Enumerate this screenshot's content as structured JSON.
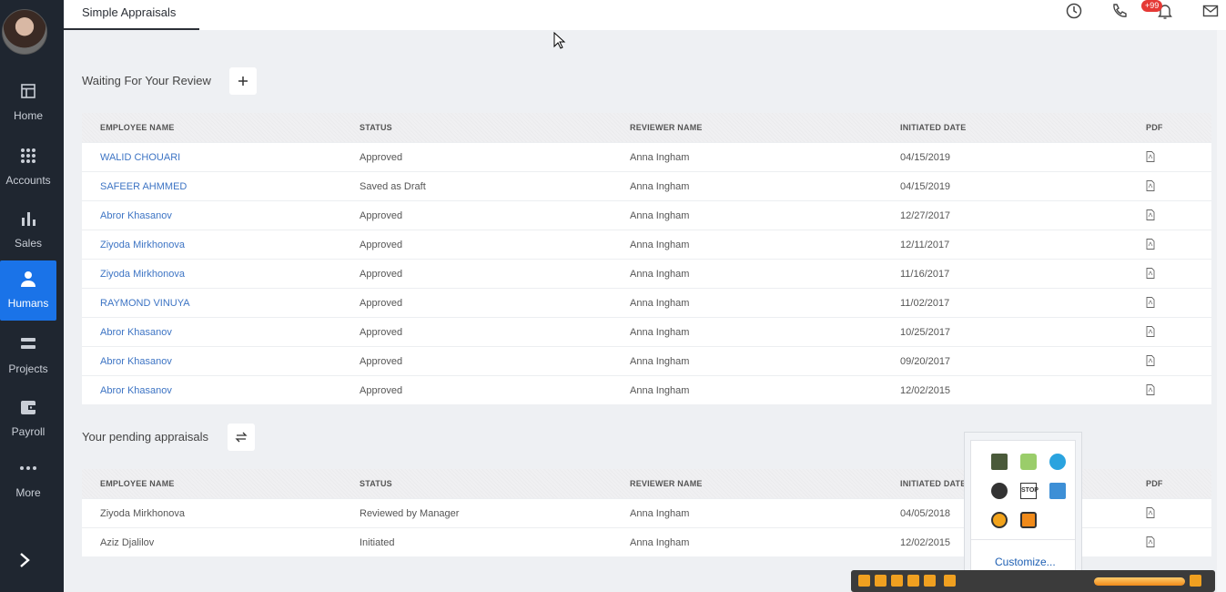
{
  "sidebar": {
    "items": [
      {
        "label": "Home",
        "icon": "layout-icon"
      },
      {
        "label": "Accounts",
        "icon": "grid-icon"
      },
      {
        "label": "Sales",
        "icon": "bar-chart-icon"
      },
      {
        "label": "Humans",
        "icon": "person-icon",
        "active": true
      },
      {
        "label": "Projects",
        "icon": "stack-icon"
      },
      {
        "label": "Payroll",
        "icon": "wallet-icon"
      },
      {
        "label": "More",
        "icon": "more-icon"
      }
    ]
  },
  "topbar": {
    "tab_label": "Simple Appraisals",
    "notification_count": "+99"
  },
  "review_section": {
    "title": "Waiting For Your Review",
    "columns": [
      "EMPLOYEE NAME",
      "STATUS",
      "REVIEWER NAME",
      "INITIATED DATE",
      "PDF"
    ],
    "rows": [
      [
        "WALID CHOUARI",
        "Approved",
        "Anna Ingham",
        "04/15/2019"
      ],
      [
        "SAFEER AHMMED",
        "Saved as Draft",
        "Anna Ingham",
        "04/15/2019"
      ],
      [
        "Abror Khasanov",
        "Approved",
        "Anna Ingham",
        "12/27/2017"
      ],
      [
        "Ziyoda Mirkhonova",
        "Approved",
        "Anna Ingham",
        "12/11/2017"
      ],
      [
        "Ziyoda Mirkhonova",
        "Approved",
        "Anna Ingham",
        "11/16/2017"
      ],
      [
        "RAYMOND VINUYA",
        "Approved",
        "Anna Ingham",
        "11/02/2017"
      ],
      [
        "Abror Khasanov",
        "Approved",
        "Anna Ingham",
        "10/25/2017"
      ],
      [
        "Abror Khasanov",
        "Approved",
        "Anna Ingham",
        "09/20/2017"
      ],
      [
        "Abror Khasanov",
        "Approved",
        "Anna Ingham",
        "12/02/2015"
      ]
    ]
  },
  "pending_section": {
    "title": "Your pending appraisals",
    "columns": [
      "EMPLOYEE NAME",
      "STATUS",
      "REVIEWER NAME",
      "INITIATED DATE",
      "PDF"
    ],
    "rows": [
      [
        "Ziyoda Mirkhonova",
        "Reviewed by Manager",
        "Anna Ingham",
        "04/05/2018"
      ],
      [
        "Aziz Djalilov",
        "Initiated",
        "Anna Ingham",
        "12/02/2015"
      ]
    ]
  },
  "tray_popup": {
    "customize_label": "Customize..."
  },
  "colors": {
    "sidebar_bg": "#1f2630",
    "active_nav": "#1a73e8",
    "link": "#3d74c4",
    "badge": "#e53935"
  }
}
